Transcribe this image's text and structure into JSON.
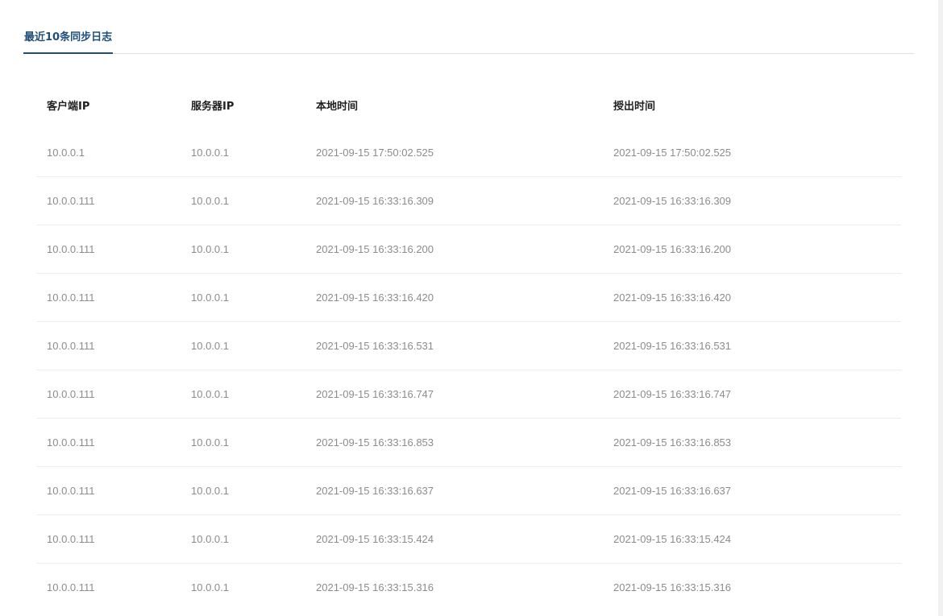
{
  "tabs": [
    {
      "label": "最近10条同步日志",
      "active": true
    }
  ],
  "colors": {
    "accent": "#1f4e79",
    "header_text": "#1f1f1f",
    "cell_text": "#8c8c8c",
    "divider": "#ebeef5"
  },
  "table": {
    "columns": [
      "客户端IP",
      "服务器IP",
      "本地时间",
      "授出时间"
    ],
    "rows": [
      [
        "10.0.0.1",
        "10.0.0.1",
        "2021-09-15 17:50:02.525",
        "2021-09-15 17:50:02.525"
      ],
      [
        "10.0.0.111",
        "10.0.0.1",
        "2021-09-15 16:33:16.309",
        "2021-09-15 16:33:16.309"
      ],
      [
        "10.0.0.111",
        "10.0.0.1",
        "2021-09-15 16:33:16.200",
        "2021-09-15 16:33:16.200"
      ],
      [
        "10.0.0.111",
        "10.0.0.1",
        "2021-09-15 16:33:16.420",
        "2021-09-15 16:33:16.420"
      ],
      [
        "10.0.0.111",
        "10.0.0.1",
        "2021-09-15 16:33:16.531",
        "2021-09-15 16:33:16.531"
      ],
      [
        "10.0.0.111",
        "10.0.0.1",
        "2021-09-15 16:33:16.747",
        "2021-09-15 16:33:16.747"
      ],
      [
        "10.0.0.111",
        "10.0.0.1",
        "2021-09-15 16:33:16.853",
        "2021-09-15 16:33:16.853"
      ],
      [
        "10.0.0.111",
        "10.0.0.1",
        "2021-09-15 16:33:16.637",
        "2021-09-15 16:33:16.637"
      ],
      [
        "10.0.0.111",
        "10.0.0.1",
        "2021-09-15 16:33:15.424",
        "2021-09-15 16:33:15.424"
      ],
      [
        "10.0.0.111",
        "10.0.0.1",
        "2021-09-15 16:33:15.316",
        "2021-09-15 16:33:15.316"
      ]
    ]
  }
}
